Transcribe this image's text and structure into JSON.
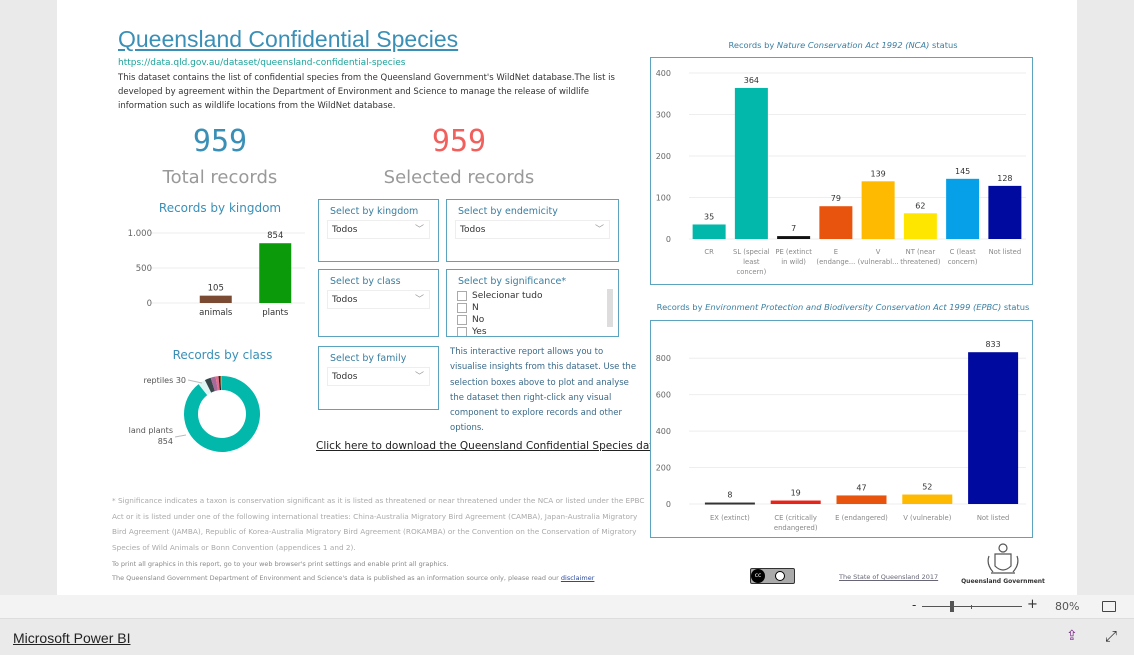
{
  "header": {
    "title": "Queensland Confidential Species",
    "url": "https://data.qld.gov.au/dataset/queensland-confidential-species",
    "description": "This dataset contains the list of confidential species from the Queensland Government's WildNet database.The list is developed by agreement within the Department of Environment and Science to manage the release of wildlife information such as wildlife locations from the WildNet database."
  },
  "cards": {
    "total_value": "959",
    "total_label": "Total records",
    "selected_value": "959",
    "selected_label": "Selected records"
  },
  "slicers": {
    "kingdom": {
      "label": "Select by kingdom",
      "value": "Todos"
    },
    "endemicity": {
      "label": "Select by endemicity",
      "value": "Todos"
    },
    "class": {
      "label": "Select by class",
      "value": "Todos"
    },
    "family": {
      "label": "Select by family",
      "value": "Todos"
    },
    "significance": {
      "label": "Select by significance*",
      "options": [
        "Selecionar tudo",
        "N",
        "No",
        "Yes"
      ]
    }
  },
  "info_text": "This interactive report allows you to visualise insights from this dataset.  Use the selection boxes above to plot and analyse the dataset then right-click any visual component to explore records and other options.",
  "download_link": "Click here to download the Queensland Confidential Species dataset.",
  "footnote": "* Significance indicates a taxon is conservation significant as it is listed as threatened or near threatened under the NCA or listed under the EPBC Act or it is listed under one of the following international treaties: China-Australia Migratory Bird Agreement (CAMBA), Japan-Australia Migratory Bird Agreement (JAMBA), Republic of Korea-Australia Migratory Bird Agreement (ROKAMBA) or the Convention on the Conservation of Migratory Species of Wild Animals or Bonn Convention (appendices 1 and 2).",
  "print_note": "To print all graphics in this report, go to your web browser's print settings and enable print all graphics.",
  "disclaimer_note": "The Queensland Government Department of Environment and Science's data is published as an information source only, please read our ",
  "disclaimer_link": "disclaimer",
  "copyright_link": "The State of Queensland 2017",
  "logo_text": "Queensland Government",
  "cc_badge": "cc by",
  "zoom": {
    "minus": "-",
    "plus": "+",
    "level": "80%",
    "slider_percent": 0.3
  },
  "footer": {
    "brand": "Microsoft Power BI"
  },
  "chart_data": [
    {
      "id": "kingdom",
      "type": "bar",
      "title": "Records by kingdom",
      "categories": [
        "animals",
        "plants"
      ],
      "values": [
        105,
        854
      ],
      "colors": [
        "#7b4a32",
        "#0a9a0a"
      ],
      "yticks": [
        "0",
        "500",
        "1.000"
      ],
      "ylim": [
        0,
        1000
      ],
      "grid": true
    },
    {
      "id": "class",
      "type": "pie",
      "title": "Records by class",
      "slices": [
        {
          "name": "land plants",
          "value": 854,
          "color": "#01b8aa"
        },
        {
          "name": "reptiles",
          "value": 30,
          "color": "#dff5f3"
        },
        {
          "value": 25,
          "color": "#374649"
        },
        {
          "value": 20,
          "color": "#a66999"
        },
        {
          "value": 12,
          "color": "#e66c8c"
        },
        {
          "value": 8,
          "color": "#222222"
        },
        {
          "value": 6,
          "color": "#fd8c2c"
        }
      ],
      "labels": [
        {
          "text": "reptiles 30"
        },
        {
          "text": "land plants",
          "value": "854"
        }
      ]
    },
    {
      "id": "nca",
      "type": "bar",
      "title_prefix": "Records by ",
      "title_italic": "Nature Conservation Act 1992 (NCA)",
      "title_suffix": " status",
      "categories": [
        [
          "CR"
        ],
        [
          "SL (special",
          "least",
          "concern)"
        ],
        [
          "PE (extinct",
          "in wild)"
        ],
        [
          "E",
          "(endange..."
        ],
        [
          "V",
          "(vulnerabl..."
        ],
        [
          "NT (near",
          "threatened)"
        ],
        [
          "C (least",
          "concern)"
        ],
        [
          "Not listed"
        ]
      ],
      "values": [
        35,
        364,
        7,
        79,
        139,
        62,
        145,
        128
      ],
      "colors": [
        "#01b8aa",
        "#01b8aa",
        "#111111",
        "#e8540e",
        "#fdba00",
        "#ffe600",
        "#06a0e8",
        "#000a9e"
      ],
      "yticks": [
        0,
        100,
        200,
        300,
        400
      ],
      "ylim": [
        0,
        400
      ],
      "grid": true
    },
    {
      "id": "epbc",
      "type": "bar",
      "title_prefix": "Records by ",
      "title_italic": "Environment Protection and Biodiversity Conservation Act 1999 (EPBC)",
      "title_suffix": " status",
      "categories": [
        [
          "EX (extinct)"
        ],
        [
          "CE (critically",
          "endangered)"
        ],
        [
          "E (endangered)"
        ],
        [
          "V (vulnerable)"
        ],
        [
          "Not listed"
        ]
      ],
      "values": [
        8,
        19,
        47,
        52,
        833
      ],
      "colors": [
        "#333333",
        "#e8231a",
        "#e8540e",
        "#fdba00",
        "#000a9e"
      ],
      "yticks": [
        0,
        200,
        400,
        600,
        800
      ],
      "ylim": [
        0,
        900
      ],
      "grid": true
    }
  ]
}
